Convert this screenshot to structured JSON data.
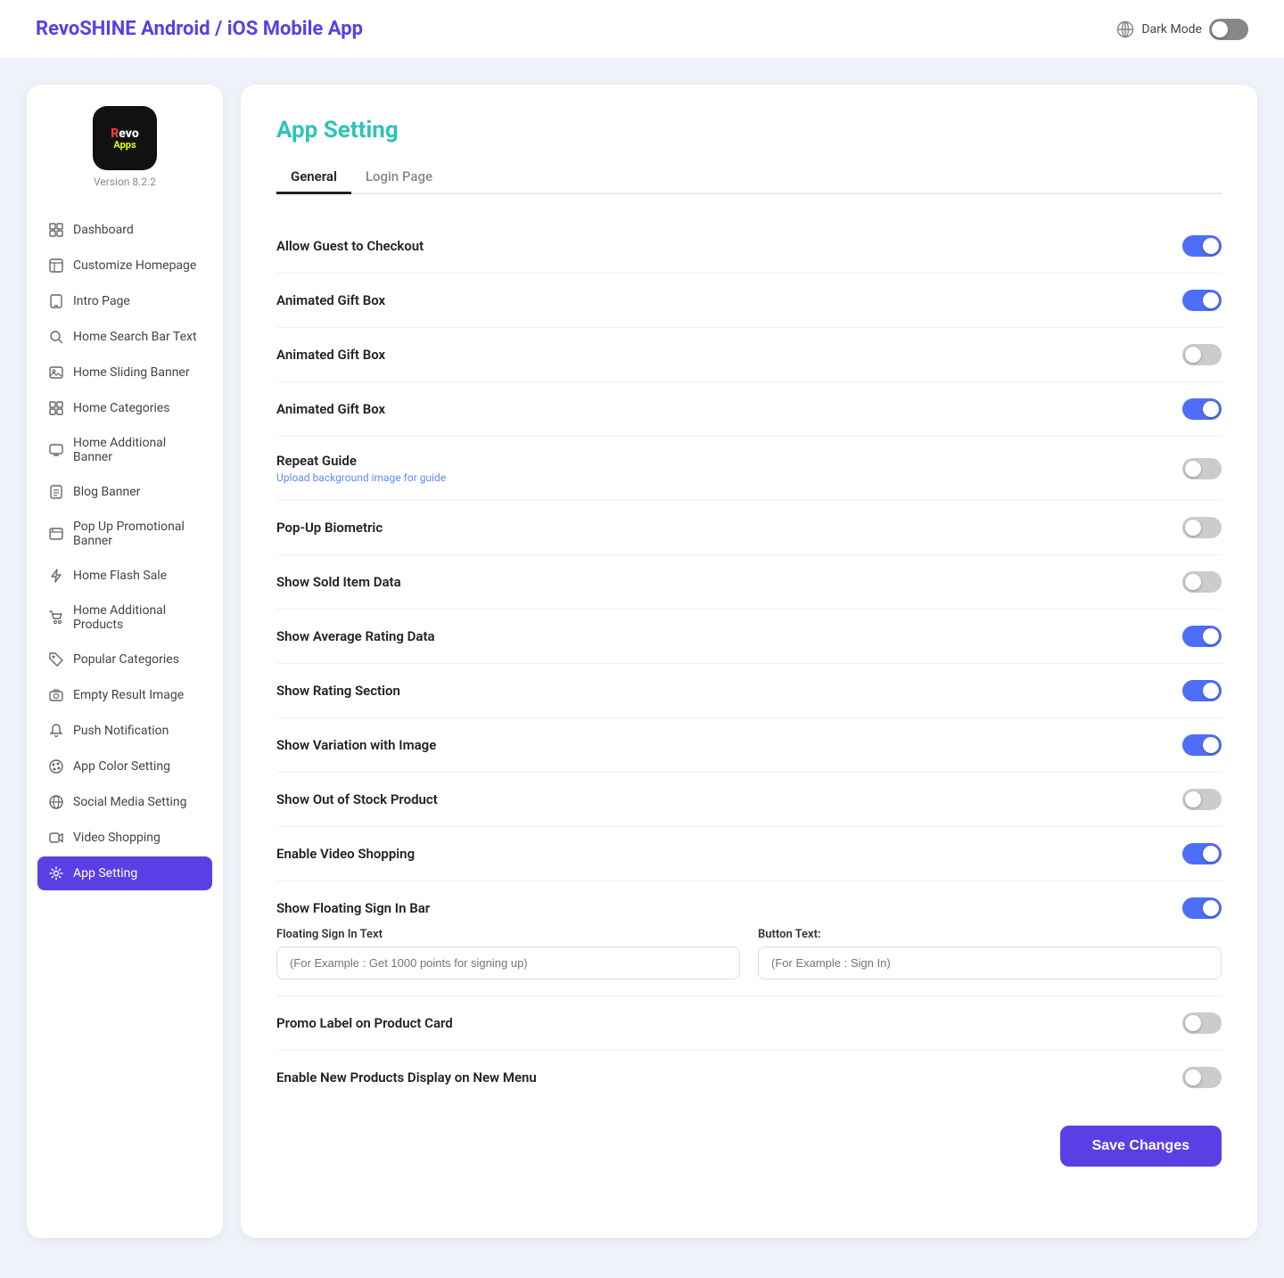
{
  "header": {
    "title": "RevoSHINE Android / iOS Mobile App",
    "dark_mode_label": "Dark Mode",
    "dark_mode_enabled": false
  },
  "sidebar": {
    "logo_top": "Revo",
    "logo_bottom": "Apps",
    "version": "Version 8.2.2",
    "nav_items": [
      {
        "id": "dashboard",
        "label": "Dashboard",
        "icon": "grid-icon",
        "active": false
      },
      {
        "id": "customize-homepage",
        "label": "Customize Homepage",
        "icon": "layout-icon",
        "active": false
      },
      {
        "id": "intro-page",
        "label": "Intro Page",
        "icon": "phone-icon",
        "active": false
      },
      {
        "id": "home-search-bar-text",
        "label": "Home Search Bar Text",
        "icon": "search-icon",
        "active": false
      },
      {
        "id": "home-sliding-banner",
        "label": "Home Sliding Banner",
        "icon": "image-icon",
        "active": false
      },
      {
        "id": "home-categories",
        "label": "Home Categories",
        "icon": "grid2-icon",
        "active": false
      },
      {
        "id": "home-additional-banner",
        "label": "Home Additional Banner",
        "icon": "monitor-icon",
        "active": false
      },
      {
        "id": "blog-banner",
        "label": "Blog Banner",
        "icon": "file-icon",
        "active": false
      },
      {
        "id": "pop-up-promotional-banner",
        "label": "Pop Up Promotional Banner",
        "icon": "browser-icon",
        "active": false
      },
      {
        "id": "home-flash-sale",
        "label": "Home Flash Sale",
        "icon": "flash-icon",
        "active": false
      },
      {
        "id": "home-additional-products",
        "label": "Home Additional Products",
        "icon": "cart-icon",
        "active": false
      },
      {
        "id": "popular-categories",
        "label": "Popular Categories",
        "icon": "tag-icon",
        "active": false
      },
      {
        "id": "empty-result-image",
        "label": "Empty Result Image",
        "icon": "camera-icon",
        "active": false
      },
      {
        "id": "push-notification",
        "label": "Push Notification",
        "icon": "bell-icon",
        "active": false
      },
      {
        "id": "app-color-setting",
        "label": "App Color Setting",
        "icon": "palette-icon",
        "active": false
      },
      {
        "id": "social-media-setting",
        "label": "Social Media Setting",
        "icon": "globe-icon",
        "active": false
      },
      {
        "id": "video-shopping",
        "label": "Video Shopping",
        "icon": "video-icon",
        "active": false
      },
      {
        "id": "app-setting",
        "label": "App Setting",
        "icon": "gear-icon",
        "active": true
      }
    ]
  },
  "content": {
    "title": "App Setting",
    "tabs": [
      {
        "id": "general",
        "label": "General",
        "active": true
      },
      {
        "id": "login-page",
        "label": "Login Page",
        "active": false
      }
    ],
    "settings": [
      {
        "id": "allow-guest-checkout",
        "label": "Allow Guest to Checkout",
        "enabled": true,
        "sublabel": null
      },
      {
        "id": "animated-gift-box-1",
        "label": "Animated Gift Box",
        "enabled": true,
        "sublabel": null
      },
      {
        "id": "animated-gift-box-2",
        "label": "Animated Gift Box",
        "enabled": false,
        "sublabel": null
      },
      {
        "id": "animated-gift-box-3",
        "label": "Animated Gift Box",
        "enabled": true,
        "sublabel": null
      },
      {
        "id": "repeat-guide",
        "label": "Repeat Guide",
        "enabled": false,
        "sublabel": "Upload background image for guide"
      },
      {
        "id": "pop-up-biometric",
        "label": "Pop-Up Biometric",
        "enabled": false,
        "sublabel": null
      },
      {
        "id": "show-sold-item-data",
        "label": "Show Sold Item Data",
        "enabled": false,
        "sublabel": null
      },
      {
        "id": "show-average-rating-data",
        "label": "Show Average Rating Data",
        "enabled": true,
        "sublabel": null
      },
      {
        "id": "show-rating-section",
        "label": "Show Rating Section",
        "enabled": true,
        "sublabel": null
      },
      {
        "id": "show-variation-with-image",
        "label": "Show Variation with Image",
        "enabled": true,
        "sublabel": null
      },
      {
        "id": "show-out-of-stock-product",
        "label": "Show Out of Stock Product",
        "enabled": false,
        "sublabel": null
      },
      {
        "id": "enable-video-shopping",
        "label": "Enable Video Shopping",
        "enabled": true,
        "sublabel": null
      },
      {
        "id": "show-floating-sign-in-bar",
        "label": "Show Floating Sign In Bar",
        "enabled": true,
        "sublabel": null,
        "has_inputs": true,
        "floating_sign_in_text_label": "Floating Sign In Text",
        "floating_sign_in_placeholder": "(For Example : Get 1000 points for signing up)",
        "button_text_label": "Button Text:",
        "button_text_placeholder": "(For Example : Sign In)"
      },
      {
        "id": "promo-label-product-card",
        "label": "Promo Label on Product Card",
        "enabled": false,
        "sublabel": null
      },
      {
        "id": "enable-new-products-display",
        "label": "Enable New Products Display on New Menu",
        "enabled": false,
        "sublabel": null
      }
    ],
    "save_button_label": "Save Changes"
  }
}
